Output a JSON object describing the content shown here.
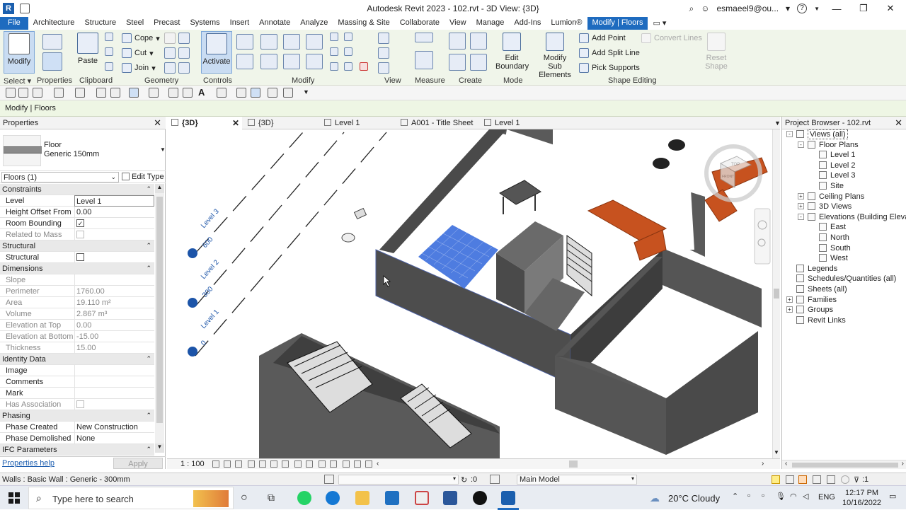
{
  "window": {
    "title": "Autodesk Revit 2023 - 102.rvt - 3D View: {3D}",
    "user": "esmaeel9@ou...",
    "app_icon_letter": "R"
  },
  "tabs": [
    {
      "label": "File"
    },
    {
      "label": "Architecture"
    },
    {
      "label": "Structure"
    },
    {
      "label": "Steel"
    },
    {
      "label": "Precast"
    },
    {
      "label": "Systems"
    },
    {
      "label": "Insert"
    },
    {
      "label": "Annotate"
    },
    {
      "label": "Analyze"
    },
    {
      "label": "Massing & Site"
    },
    {
      "label": "Collaborate"
    },
    {
      "label": "View"
    },
    {
      "label": "Manage"
    },
    {
      "label": "Add-Ins"
    },
    {
      "label": "Lumion®"
    },
    {
      "label": "Modify | Floors"
    }
  ],
  "ribbon": {
    "modify": "Modify",
    "paste": "Paste",
    "cope": "Cope",
    "cut": "Cut",
    "join": "Join",
    "activate": "Activate",
    "edit_boundary": "Edit\nBoundary",
    "edit_boundary_1": "Edit",
    "edit_boundary_2": "Boundary",
    "modify_sub_1": "Modify",
    "modify_sub_2": "Sub Elements",
    "add_point": "Add Point",
    "add_split_line": "Add Split Line",
    "pick_supports": "Pick Supports",
    "convert_lines": "Convert Lines",
    "reset_1": "Reset",
    "reset_2": "Shape",
    "panels": {
      "select": "Select",
      "properties": "Properties",
      "clipboard": "Clipboard",
      "geometry": "Geometry",
      "controls": "Controls",
      "modify": "Modify",
      "view": "View",
      "measure": "Measure",
      "create": "Create",
      "mode": "Mode",
      "shape_editing": "Shape Editing"
    }
  },
  "context_bar": "Modify | Floors",
  "properties": {
    "title": "Properties",
    "family": "Floor",
    "type": "Generic 150mm",
    "selector": "Floors (1)",
    "edit_type": "Edit Type",
    "rows": [
      {
        "group": "Constraints"
      },
      {
        "k": "Level",
        "v": "Level 1",
        "box": true
      },
      {
        "k": "Height Offset From ...",
        "v": "0.00"
      },
      {
        "k": "Room Bounding",
        "check": "✓"
      },
      {
        "k": "Related to Mass",
        "check": "",
        "dis": true
      },
      {
        "group": "Structural"
      },
      {
        "k": "Structural",
        "check": ""
      },
      {
        "group": "Dimensions"
      },
      {
        "k": "Slope",
        "v": "",
        "dis": true
      },
      {
        "k": "Perimeter",
        "v": "1760.00",
        "dis": true
      },
      {
        "k": "Area",
        "v": "19.110 m²",
        "dis": true
      },
      {
        "k": "Volume",
        "v": "2.867 m³",
        "dis": true
      },
      {
        "k": "Elevation at Top",
        "v": "0.00",
        "dis": true
      },
      {
        "k": "Elevation at Bottom",
        "v": "-15.00",
        "dis": true
      },
      {
        "k": "Thickness",
        "v": "15.00",
        "dis": true
      },
      {
        "group": "Identity Data"
      },
      {
        "k": "Image",
        "v": ""
      },
      {
        "k": "Comments",
        "v": ""
      },
      {
        "k": "Mark",
        "v": ""
      },
      {
        "k": "Has Association",
        "check": "",
        "dis": true
      },
      {
        "group": "Phasing"
      },
      {
        "k": "Phase Created",
        "v": "New Construction"
      },
      {
        "k": "Phase Demolished",
        "v": "None"
      },
      {
        "group": "IFC Parameters"
      }
    ],
    "help": "Properties help",
    "apply": "Apply"
  },
  "view_tabs": [
    {
      "label": "{3D}",
      "active": true
    },
    {
      "label": "{3D}"
    },
    {
      "label": "Level 1"
    },
    {
      "label": "A001 - Title Sheet"
    },
    {
      "label": "Level 1"
    }
  ],
  "viewport": {
    "levels": [
      {
        "name": "Level 3",
        "elev": "600"
      },
      {
        "name": "Level 2",
        "elev": "300"
      },
      {
        "name": "Level 1",
        "elev": "0"
      }
    ],
    "scale": "1 : 100",
    "viewcube_top": "TOP",
    "viewcube_front": "FRONT"
  },
  "browser": {
    "title": "Project Browser - 102.rvt",
    "nodes": [
      {
        "label": "Views (all)",
        "depth": 0,
        "exp": "-",
        "selv": true
      },
      {
        "label": "Floor Plans",
        "depth": 1,
        "exp": "-"
      },
      {
        "label": "Level 1",
        "depth": 2,
        "icon": true
      },
      {
        "label": "Level 2",
        "depth": 2,
        "icon": true
      },
      {
        "label": "Level 3",
        "depth": 2,
        "icon": true
      },
      {
        "label": "Site",
        "depth": 2,
        "icon": true
      },
      {
        "label": "Ceiling Plans",
        "depth": 1,
        "exp": "+"
      },
      {
        "label": "3D Views",
        "depth": 1,
        "exp": "+"
      },
      {
        "label": "Elevations (Building Elevation",
        "depth": 1,
        "exp": "-"
      },
      {
        "label": "East",
        "depth": 2,
        "icon": true
      },
      {
        "label": "North",
        "depth": 2,
        "icon": true
      },
      {
        "label": "South",
        "depth": 2,
        "icon": true
      },
      {
        "label": "West",
        "depth": 2,
        "icon": true
      },
      {
        "label": "Legends",
        "depth": 0,
        "icon": true
      },
      {
        "label": "Schedules/Quantities (all)",
        "depth": 0,
        "icon": true
      },
      {
        "label": "Sheets (all)",
        "depth": 0,
        "icon": true
      },
      {
        "label": "Families",
        "depth": 0,
        "exp": "+",
        "icon": true
      },
      {
        "label": "Groups",
        "depth": 0,
        "exp": "+",
        "icon": true
      },
      {
        "label": "Revit Links",
        "depth": 0,
        "icon": true
      }
    ]
  },
  "status": {
    "text": "Walls : Basic Wall : Generic - 300mm",
    "zero": ":0",
    "model": "Main Model",
    "filter": ":1"
  },
  "taskbar": {
    "search": "Type here to search",
    "weather": "20°C  Cloudy",
    "lang": "ENG",
    "time": "12:17 PM",
    "date": "10/16/2022"
  }
}
